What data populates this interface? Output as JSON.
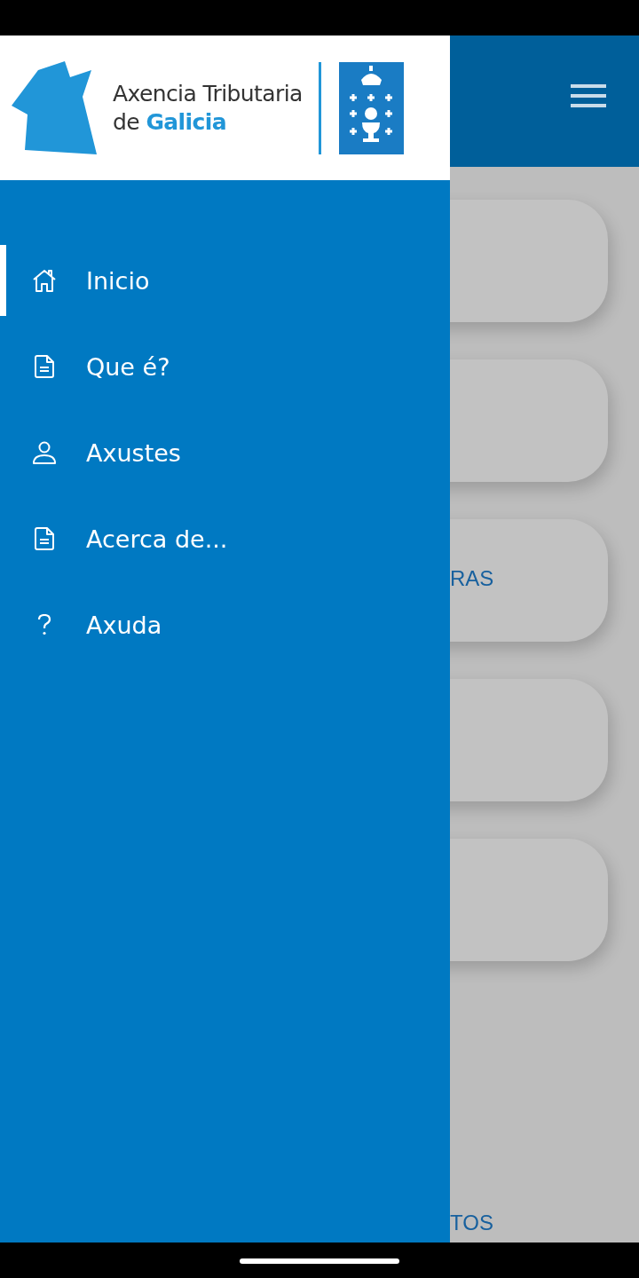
{
  "drawer": {
    "logo": {
      "line_1": "Axencia Tributaria",
      "line_2": "de **Galicia**"
    },
    "items": [
      {
        "label": "Inicio",
        "kind": "home",
        "selected": true
      },
      {
        "label": "Que é?",
        "kind": "document",
        "selected": false
      },
      {
        "label": "Axustes",
        "kind": "person",
        "selected": false
      },
      {
        "label": "Acerca de...",
        "kind": "document",
        "selected": false
      },
      {
        "label": "Axuda",
        "kind": "help",
        "selected": false
      }
    ]
  },
  "background": {
    "cards": [
      {
        "kind": "blank"
      },
      {
        "kind": "blank"
      },
      {
        "kind": "labeled",
        "label": "RAS"
      },
      {
        "kind": "blank"
      },
      {
        "kind": "blank"
      }
    ],
    "footer_label": "TOS"
  }
}
